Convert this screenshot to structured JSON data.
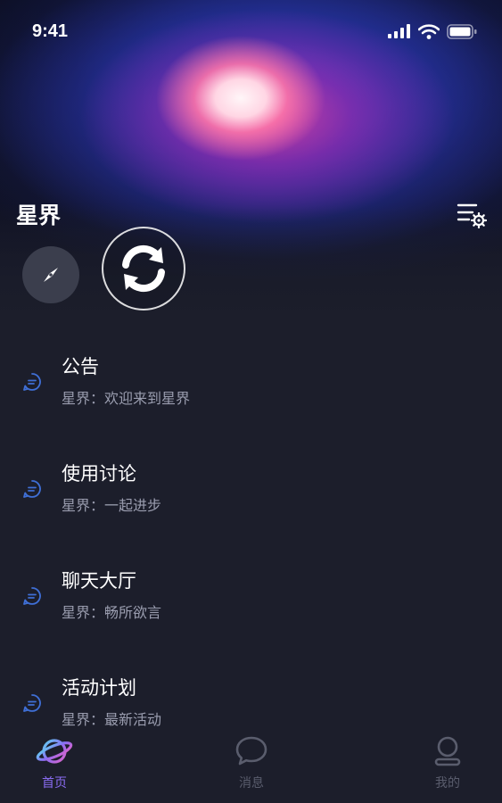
{
  "status_bar": {
    "time": "9:41"
  },
  "header": {
    "title": "星界"
  },
  "icons": {
    "settings": "list-settings-icon",
    "compass": "compass-icon",
    "refresh": "refresh-icon",
    "channel": "chat-bubble-icon"
  },
  "channels": [
    {
      "title": "公告",
      "subtitle": "星界：欢迎来到星界"
    },
    {
      "title": "使用讨论",
      "subtitle": "星界：一起进步"
    },
    {
      "title": "聊天大厅",
      "subtitle": "星界：畅所欲言"
    },
    {
      "title": "活动计划",
      "subtitle": "星界：最新活动"
    }
  ],
  "tabbar": {
    "tabs": [
      {
        "label": "首页",
        "icon": "planet-icon",
        "active": true
      },
      {
        "label": "消息",
        "icon": "message-icon",
        "active": false
      },
      {
        "label": "我的",
        "icon": "profile-icon",
        "active": false
      }
    ]
  },
  "colors": {
    "accent": "#8a6cf2",
    "inactive": "#5a5d6d",
    "background": "#1c1e2b",
    "channel_icon": "#3f6fd6"
  }
}
